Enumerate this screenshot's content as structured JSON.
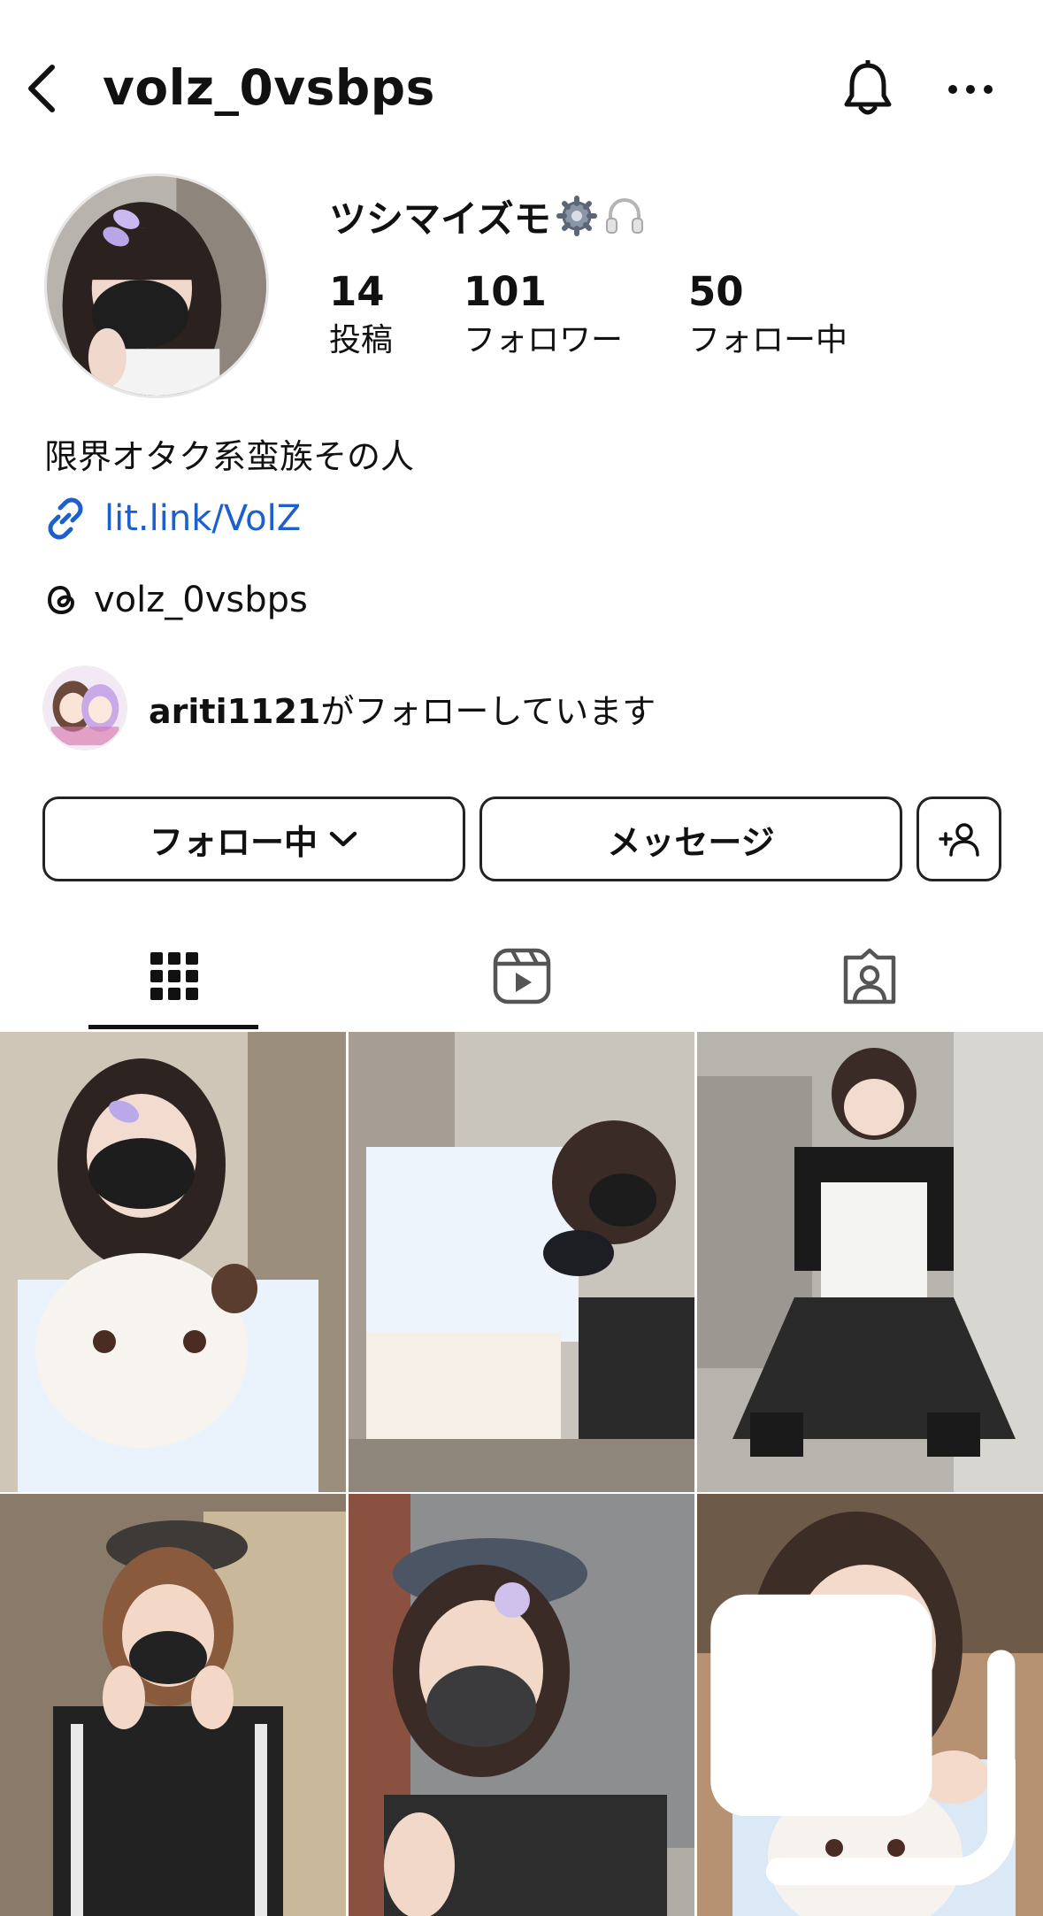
{
  "header": {
    "username": "volz_0vsbps"
  },
  "profile": {
    "display_name": "ツシマイズモ",
    "stats": [
      {
        "num": "14",
        "label": "投稿"
      },
      {
        "num": "101",
        "label": "フォロワー"
      },
      {
        "num": "50",
        "label": "フォロー中"
      }
    ],
    "bio": "限界オタク系蛮族その人",
    "link": "lit.link/VolZ",
    "threads": "volz_0vsbps",
    "followed_by_user": "ariti1121",
    "followed_by_suffix": "がフォローしています"
  },
  "actions": {
    "follow_label": "フォロー中",
    "message_label": "メッセージ"
  },
  "tabs": {
    "icons": [
      "grid-icon",
      "reels-icon",
      "tagged-icon"
    ],
    "active": "grid"
  },
  "colors": {
    "link": "#1d5fcc",
    "text": "#111111",
    "border": "#222222"
  }
}
